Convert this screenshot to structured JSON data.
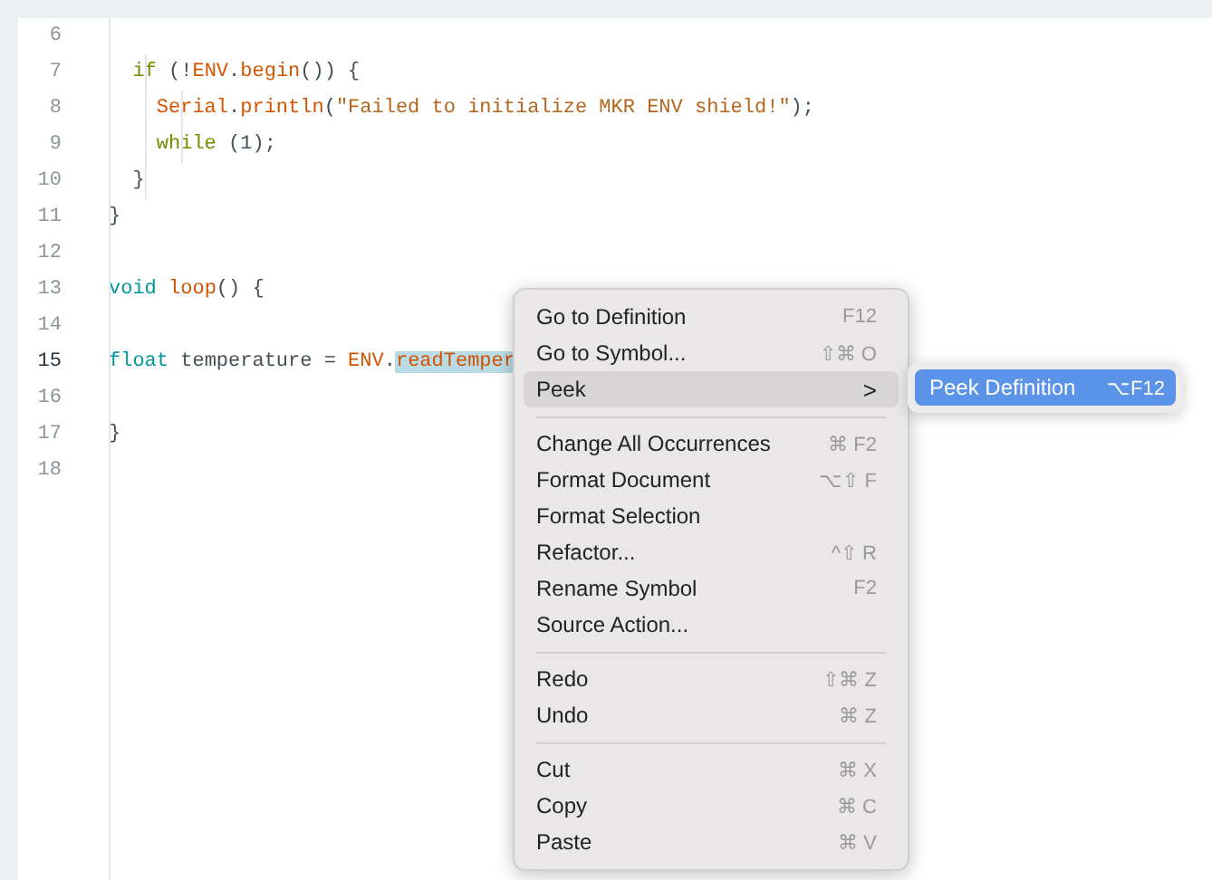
{
  "editor": {
    "lines": [
      {
        "number": "6",
        "current": false
      },
      {
        "number": "7",
        "current": false,
        "tokens": [
          {
            "kind": "keyword",
            "text": "  if"
          },
          {
            "kind": "plain",
            "text": " (!"
          },
          {
            "kind": "function",
            "text": "ENV"
          },
          {
            "kind": "plain",
            "text": "."
          },
          {
            "kind": "function",
            "text": "begin"
          },
          {
            "kind": "plain",
            "text": "()) {"
          }
        ]
      },
      {
        "number": "8",
        "current": false,
        "tokens": [
          {
            "kind": "function",
            "text": "    Serial"
          },
          {
            "kind": "plain",
            "text": "."
          },
          {
            "kind": "function",
            "text": "println"
          },
          {
            "kind": "plain",
            "text": "("
          },
          {
            "kind": "string",
            "text": "\"Failed to initialize MKR ENV shield!\""
          },
          {
            "kind": "plain",
            "text": ");"
          }
        ]
      },
      {
        "number": "9",
        "current": false,
        "tokens": [
          {
            "kind": "keyword",
            "text": "    while"
          },
          {
            "kind": "plain",
            "text": " (1);"
          }
        ]
      },
      {
        "number": "10",
        "current": false,
        "tokens": [
          {
            "kind": "plain",
            "text": "  }"
          }
        ]
      },
      {
        "number": "11",
        "current": false,
        "tokens": [
          {
            "kind": "plain",
            "text": "}"
          }
        ]
      },
      {
        "number": "12",
        "current": false
      },
      {
        "number": "13",
        "current": false,
        "tokens": [
          {
            "kind": "type",
            "text": "void "
          },
          {
            "kind": "function",
            "text": "loop"
          },
          {
            "kind": "plain",
            "text": "() {"
          }
        ]
      },
      {
        "number": "14",
        "current": false
      },
      {
        "number": "15",
        "current": true,
        "tokens": [
          {
            "kind": "type",
            "text": "float"
          },
          {
            "kind": "plain",
            "text": " temperature = "
          },
          {
            "kind": "function",
            "text": "ENV"
          },
          {
            "kind": "plain",
            "text": "."
          },
          {
            "kind": "selected",
            "text": "readTemper"
          }
        ]
      },
      {
        "number": "16",
        "current": false
      },
      {
        "number": "17",
        "current": false,
        "tokens": [
          {
            "kind": "plain",
            "text": "}"
          }
        ]
      },
      {
        "number": "18",
        "current": false
      }
    ]
  },
  "context_menu": {
    "items": [
      {
        "kind": "item",
        "label": "Go to Definition",
        "shortcut": "F12",
        "selected": false
      },
      {
        "kind": "item",
        "label": "Go to Symbol...",
        "shortcut": "⇧⌘ O",
        "selected": false
      },
      {
        "kind": "submenu",
        "label": "Peek",
        "shortcut": ">",
        "selected": true
      },
      {
        "kind": "separator"
      },
      {
        "kind": "item",
        "label": "Change All Occurrences",
        "shortcut": "⌘ F2",
        "selected": false
      },
      {
        "kind": "item",
        "label": "Format Document",
        "shortcut": "⌥⇧ F",
        "selected": false
      },
      {
        "kind": "item",
        "label": "Format Selection",
        "selected": false
      },
      {
        "kind": "item",
        "label": "Refactor...",
        "shortcut": "^⇧ R",
        "selected": false
      },
      {
        "kind": "item",
        "label": "Rename Symbol",
        "shortcut": "F2",
        "selected": false
      },
      {
        "kind": "item",
        "label": "Source Action...",
        "selected": false
      },
      {
        "kind": "separator"
      },
      {
        "kind": "item",
        "label": "Redo",
        "shortcut": "⇧⌘ Z",
        "selected": false
      },
      {
        "kind": "item",
        "label": "Undo",
        "shortcut": "⌘ Z",
        "selected": false
      },
      {
        "kind": "separator"
      },
      {
        "kind": "item",
        "label": "Cut",
        "shortcut": "⌘ X",
        "selected": false
      },
      {
        "kind": "item",
        "label": "Copy",
        "shortcut": "⌘ C",
        "selected": false
      },
      {
        "kind": "item",
        "label": "Paste",
        "shortcut": "⌘ V",
        "selected": false
      }
    ]
  },
  "submenu": {
    "items": [
      {
        "label": "Peek Definition",
        "shortcut": "⌥F12",
        "selected": true
      }
    ]
  }
}
